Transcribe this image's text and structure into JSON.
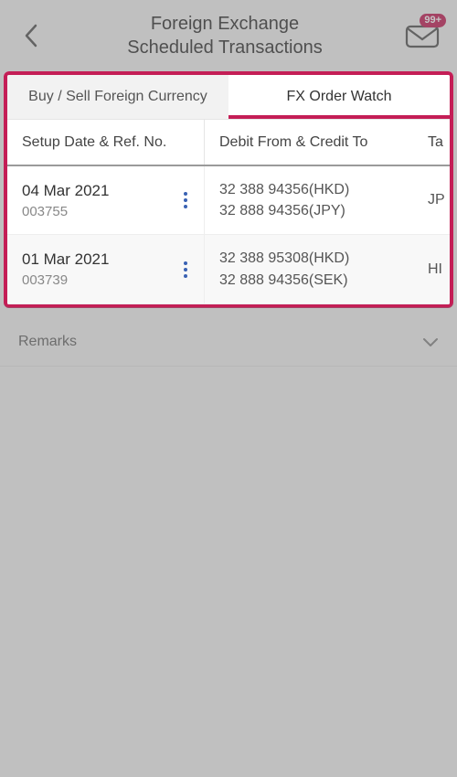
{
  "header": {
    "title_line1": "Foreign Exchange",
    "title_line2": "Scheduled Transactions",
    "badge": "99+"
  },
  "tabs": {
    "buy_sell": "Buy / Sell Foreign Currency",
    "fx_watch": "FX Order Watch"
  },
  "columns": {
    "setup": "Setup Date & Ref. No.",
    "debit": "Debit From & Credit To",
    "target_partial": "Ta"
  },
  "rows": [
    {
      "date": "04 Mar 2021",
      "ref": "003755",
      "debit_line1": "32 388 94356(HKD)",
      "debit_line2": "32 888 94356(JPY)",
      "target_partial": "JP"
    },
    {
      "date": "01 Mar 2021",
      "ref": "003739",
      "debit_line1": "32 388 95308(HKD)",
      "debit_line2": "32 888 94356(SEK)",
      "target_partial": "HI"
    }
  ],
  "remarks_label": "Remarks"
}
